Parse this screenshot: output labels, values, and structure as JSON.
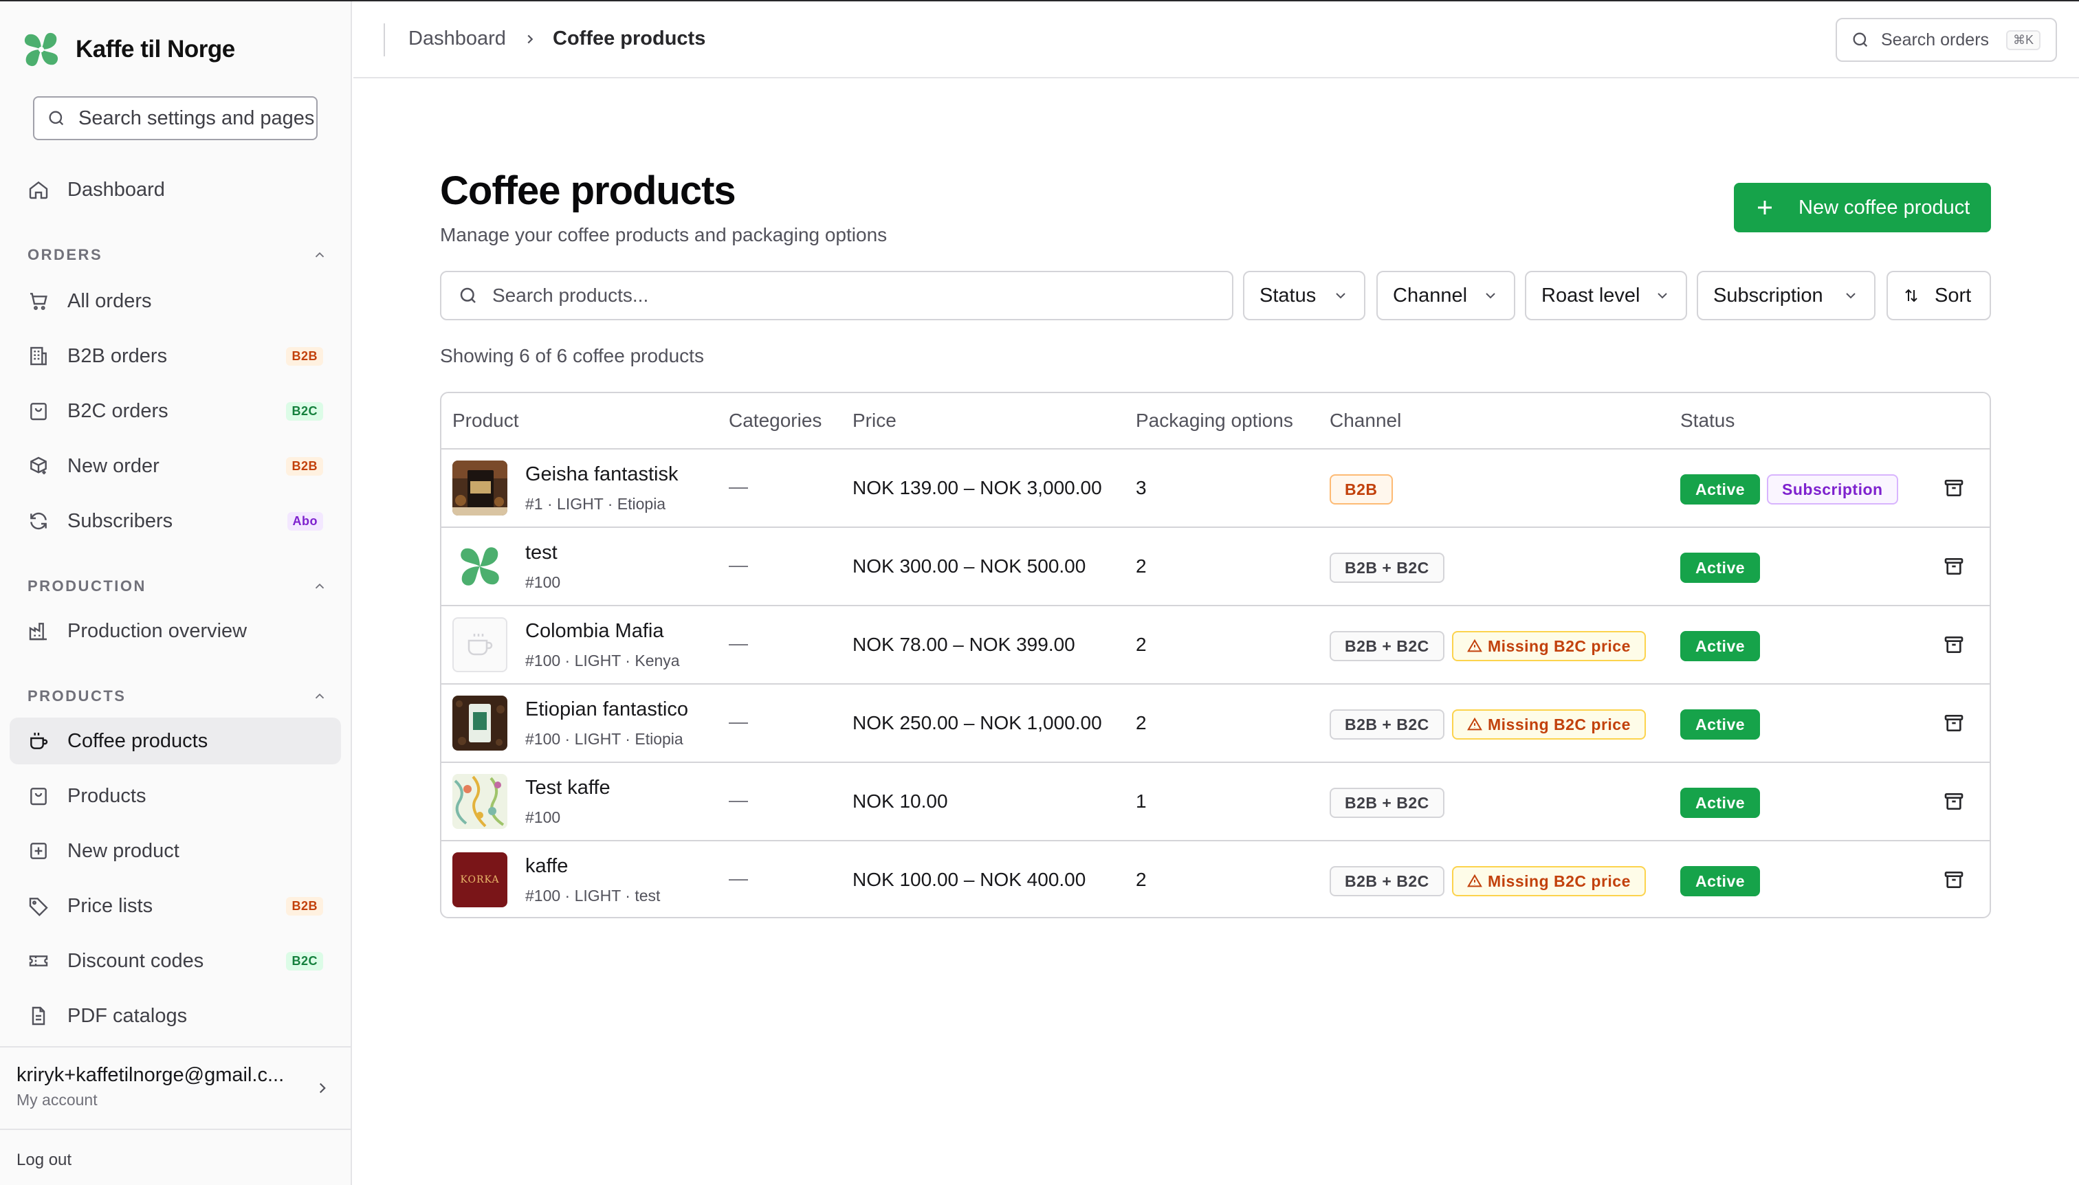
{
  "app": {
    "name": "Kaffe til Norge"
  },
  "sidebar": {
    "search_placeholder": "Search settings and pages",
    "dashboard": "Dashboard",
    "orders_section": "ORDERS",
    "production_section": "PRODUCTION",
    "products_section": "PRODUCTS",
    "items": [
      {
        "label": "All orders",
        "icon": "cart-icon"
      },
      {
        "label": "B2B orders",
        "icon": "building-icon",
        "badge": "B2B"
      },
      {
        "label": "B2C orders",
        "icon": "bag-icon",
        "badge": "B2C"
      },
      {
        "label": "New order",
        "icon": "package-plus-icon",
        "badge": "B2B"
      },
      {
        "label": "Subscribers",
        "icon": "refresh-icon",
        "badge": "Abo"
      },
      {
        "label": "Production overview",
        "icon": "factory-icon"
      },
      {
        "label": "Coffee products",
        "icon": "coffee-icon"
      },
      {
        "label": "Products",
        "icon": "bag-icon"
      },
      {
        "label": "New product",
        "icon": "plus-square-icon"
      },
      {
        "label": "Price lists",
        "icon": "tag-icon",
        "badge": "B2B"
      },
      {
        "label": "Discount codes",
        "icon": "ticket-icon",
        "badge": "B2C"
      },
      {
        "label": "PDF catalogs",
        "icon": "file-icon"
      }
    ],
    "account": {
      "email": "kriryk+kaffetilnorge@gmail.c...",
      "sub": "My account"
    },
    "logout": "Log out"
  },
  "topbar": {
    "crumb1": "Dashboard",
    "crumb2": "Coffee products",
    "search_placeholder": "Search orders",
    "shortcut": "⌘K"
  },
  "main": {
    "title": "Coffee products",
    "subtitle": "Manage your coffee products and packaging options",
    "new_button": "New coffee product",
    "search_placeholder": "Search products...",
    "filters": {
      "status": "Status",
      "channel": "Channel",
      "roast": "Roast level",
      "subscription": "Subscription",
      "sort": "Sort"
    },
    "showing": "Showing 6 of 6 coffee products"
  },
  "table": {
    "columns": {
      "product": "Product",
      "categories": "Categories",
      "price": "Price",
      "packaging": "Packaging options",
      "channel": "Channel",
      "status": "Status"
    },
    "rows": [
      {
        "name": "Geisha fantastisk",
        "meta": "#1 · LIGHT · Etiopia",
        "categories": "—",
        "price": "NOK 139.00 – NOK 3,000.00",
        "packaging": "3",
        "channel": "B2B",
        "warning": "",
        "status": "Active",
        "subscription": "Subscription"
      },
      {
        "name": "test",
        "meta": "#100",
        "categories": "—",
        "price": "NOK 300.00 – NOK 500.00",
        "packaging": "2",
        "channel": "B2B + B2C",
        "warning": "",
        "status": "Active",
        "subscription": ""
      },
      {
        "name": "Colombia Mafia",
        "meta": "#100 · LIGHT · Kenya",
        "categories": "—",
        "price": "NOK 78.00 – NOK 399.00",
        "packaging": "2",
        "channel": "B2B + B2C",
        "warning": "Missing B2C price",
        "status": "Active",
        "subscription": ""
      },
      {
        "name": "Etiopian fantastico",
        "meta": "#100 · LIGHT · Etiopia",
        "categories": "—",
        "price": "NOK 250.00 – NOK 1,000.00",
        "packaging": "2",
        "channel": "B2B + B2C",
        "warning": "Missing B2C price",
        "status": "Active",
        "subscription": ""
      },
      {
        "name": "Test kaffe",
        "meta": "#100",
        "categories": "—",
        "price": "NOK 10.00",
        "packaging": "1",
        "channel": "B2B + B2C",
        "warning": "",
        "status": "Active",
        "subscription": ""
      },
      {
        "name": "kaffe",
        "meta": "#100 · LIGHT · test",
        "categories": "—",
        "price": "NOK 100.00 – NOK 400.00",
        "packaging": "2",
        "channel": "B2B + B2C",
        "warning": "Missing B2C price",
        "status": "Active",
        "subscription": ""
      }
    ],
    "thumb_logo_text": "KORKA"
  },
  "colors": {
    "accent": "#16a34a",
    "warn": "#c2410c",
    "sub": "#7e22ce"
  }
}
